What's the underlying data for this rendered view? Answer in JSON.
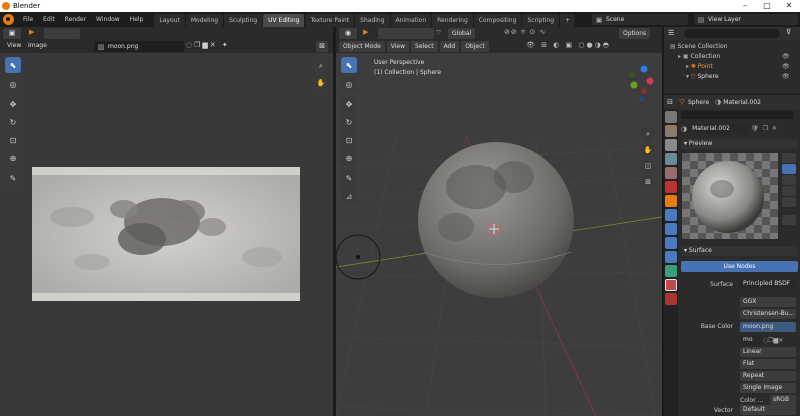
{
  "window": {
    "title": "Blender",
    "min": "–",
    "max": "□",
    "close": "✕"
  },
  "menu": [
    "File",
    "Edit",
    "Render",
    "Window",
    "Help"
  ],
  "workspaces": [
    "Layout",
    "Modeling",
    "Sculpting",
    "UV Editing",
    "Texture Paint",
    "Shading",
    "Animation",
    "Rendering",
    "Compositing",
    "Scripting"
  ],
  "active_workspace": "UV Editing",
  "add_ws": "+",
  "scene": "Scene",
  "view_layer": "View Layer",
  "uv_editor": {
    "menu": [
      "View",
      "Image"
    ],
    "image_name": "moon.png"
  },
  "viewport": {
    "mode": "Object Mode",
    "menu": [
      "View",
      "Select",
      "Add",
      "Object"
    ],
    "transform": "Global",
    "options": "Options",
    "info_line1": "User Perspective",
    "info_line2": "(1) Collection | Sphere"
  },
  "outliner": {
    "root": "Scene Collection",
    "items": [
      "Collection",
      "Point",
      "Sphere"
    ]
  },
  "properties": {
    "breadcrumb_obj": "Sphere",
    "breadcrumb_mat": "Material.002",
    "material_name": "Material.002",
    "preview_label": "Preview",
    "surface_label": "Surface",
    "use_nodes": "Use Nodes",
    "rows": [
      {
        "label": "Surface",
        "value": "Principled BSDF"
      },
      {
        "label": "",
        "value": "GGX"
      },
      {
        "label": "",
        "value": "Christensen-Bu..."
      },
      {
        "label": "Base Color",
        "value": "moon.png"
      }
    ],
    "image_field": "mo",
    "dropdowns": [
      "Linear",
      "Flat",
      "Repeat",
      "Single Image"
    ],
    "color_label": "Color ...",
    "color_value": "sRGB",
    "vector_label": "Vector",
    "vector_value": "Default"
  },
  "colors": {
    "accent": "#4772b3",
    "orange": "#e87d0d",
    "bg": "#393939"
  }
}
